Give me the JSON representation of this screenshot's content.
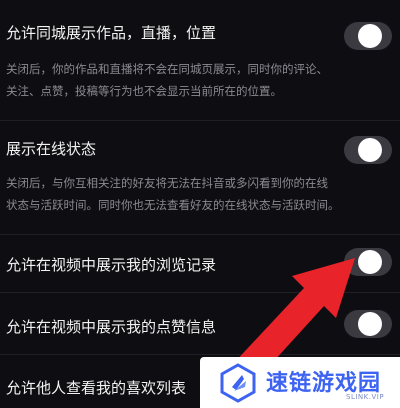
{
  "settings": [
    {
      "title": "允许同城展示作品，直播，位置",
      "desc_lines": [
        "关闭后，你的作品和直播将不会在同城页展示，同时你的评论、",
        "关注、点赞，投稿等行为也不会显示当前所在的位置。"
      ],
      "enabled": false
    },
    {
      "title": "展示在线状态",
      "desc_lines": [
        "关闭后，与你互相关注的好友将无法在抖音或多闪看到你的在线",
        "状态与活跃时间。同时你也无法查看好友的在线状态与活跃时间。"
      ],
      "enabled": false
    },
    {
      "title": "允许在视频中展示我的浏览记录",
      "enabled": false
    },
    {
      "title": "允许在视频中展示我的点赞信息",
      "enabled": false
    },
    {
      "title": "允许他人查看我的喜欢列表"
    }
  ],
  "watermark": {
    "name": "速链游戏园",
    "sub": "SLINK.VIP"
  },
  "colors": {
    "background": "#0e0e12",
    "arrow": "#e8232a",
    "watermark_blue": "#3d63f2"
  }
}
